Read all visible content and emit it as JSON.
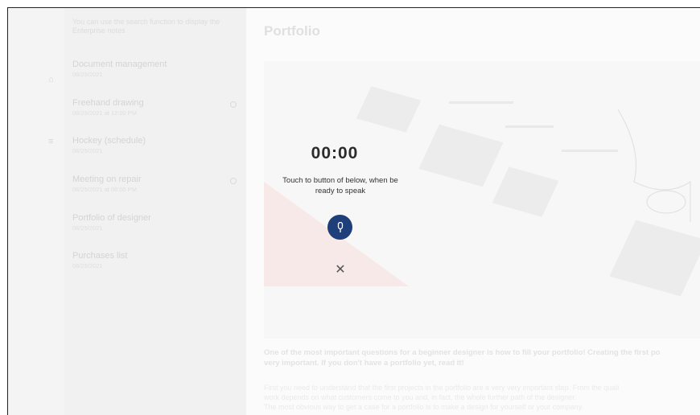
{
  "sidebar": {
    "hint": "You can use the search function to display the Enterprise notes",
    "notes": [
      {
        "title": "Document management",
        "date": "08/25/2021"
      },
      {
        "title": "Freehand drawing",
        "date": "08/25/2021 at 12:00 PM"
      },
      {
        "title": "Hockey (schedule)",
        "date": "08/25/2021"
      },
      {
        "title": "Meeting on repair",
        "date": "08/25/2021 at 08:00 PM"
      },
      {
        "title": "Portfolio of designer",
        "date": "08/25/2021"
      },
      {
        "title": "Purchases list",
        "date": "08/25/2021"
      }
    ]
  },
  "main": {
    "title": "Portfolio",
    "paragraph_bold": "One of the most important questions for a beginner designer is how to fill your portfolio! Creating the first po… very important. If you don't have a portfolio yet, read it!",
    "paragraph_bold_l1": "One of the most important questions for a beginner designer is how to fill your portfolio! Creating the first po",
    "paragraph_bold_l2": "very important. If you don't have a portfolio yet, read it!",
    "paragraph_l1": "First you need to understand that the first projects in the portfolio are a very very important step. From the quali",
    "paragraph_l2": "work depends on what customers come to you and, in fact, the whole further path of the designer.",
    "paragraph_l3": "The most obvious way to get a case for a portfolio is to make a design for yourself or your company."
  },
  "dialog": {
    "timer": "00:00",
    "prompt": "Touch to button of below, when be ready to speak",
    "mic_icon": "microphone-icon",
    "close_icon": "close-icon",
    "accent": "#1e3f7a"
  }
}
